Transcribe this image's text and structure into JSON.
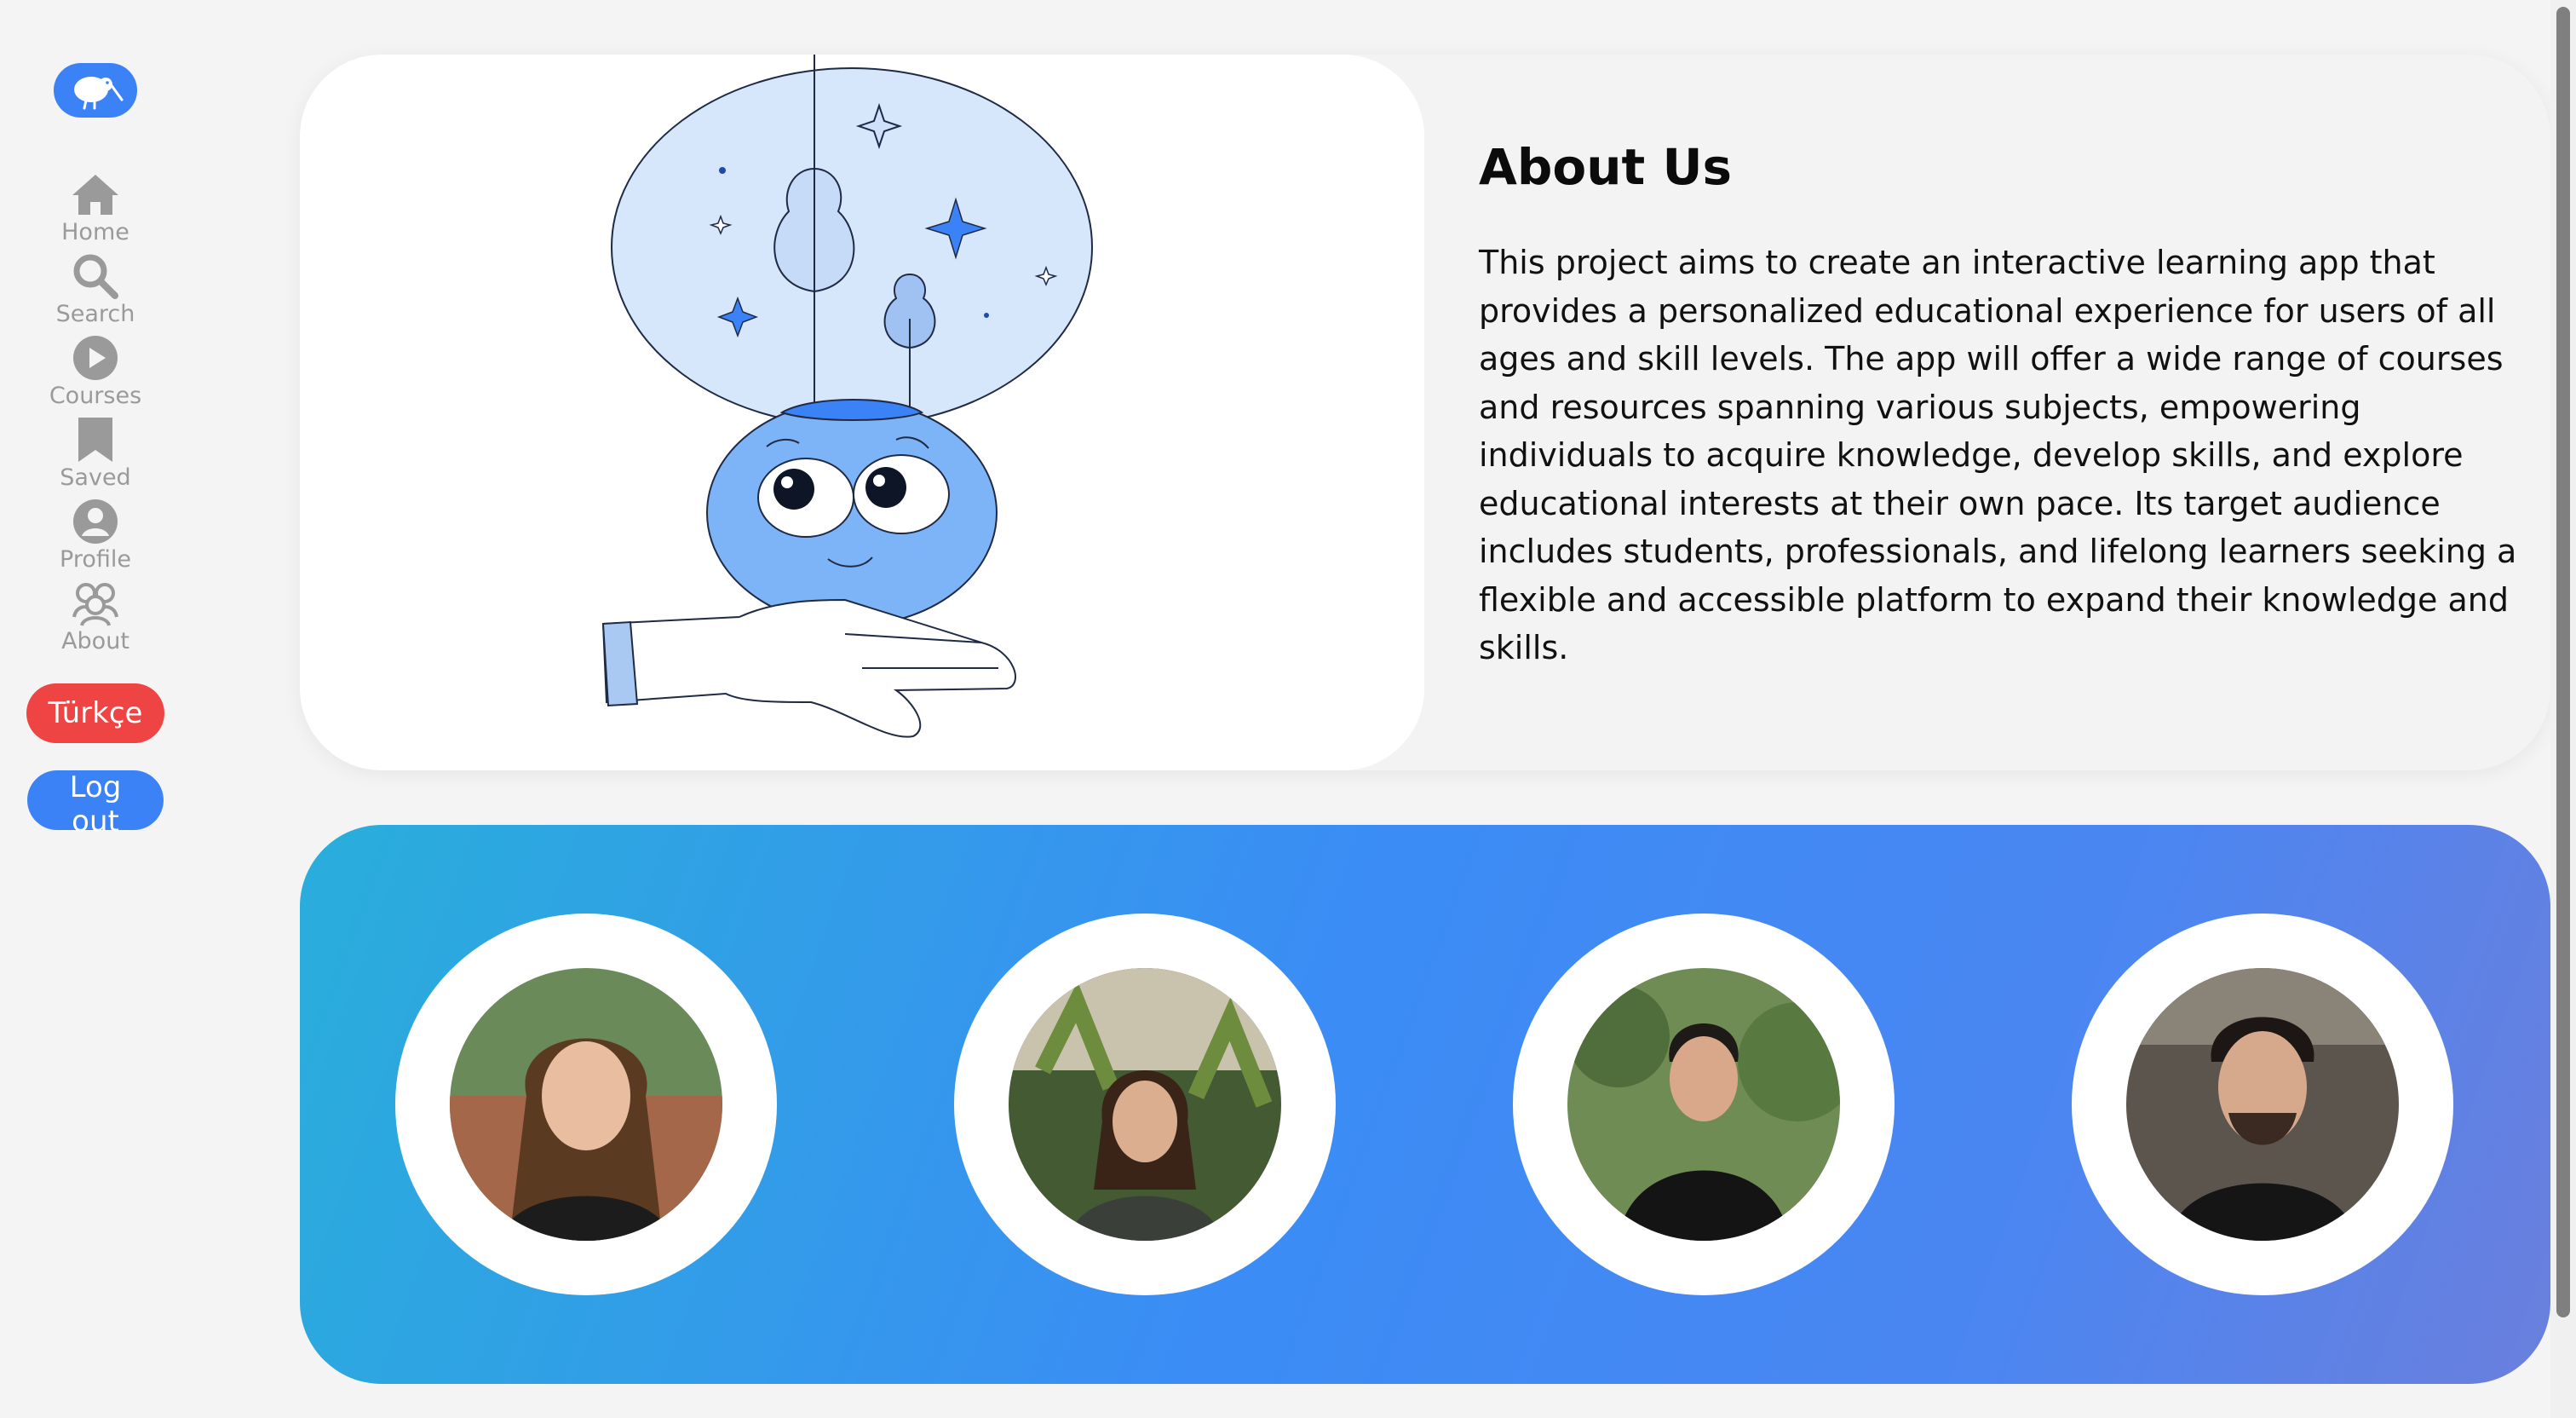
{
  "sidebar": {
    "logo_icon": "kiwi-bird-icon",
    "items": [
      {
        "label": "Home",
        "icon": "home-icon"
      },
      {
        "label": "Search",
        "icon": "search-icon"
      },
      {
        "label": "Courses",
        "icon": "play-icon"
      },
      {
        "label": "Saved",
        "icon": "bookmark-icon"
      },
      {
        "label": "Profile",
        "icon": "user-icon"
      },
      {
        "label": "About",
        "icon": "users-icon"
      }
    ],
    "language_button": "Türkçe",
    "logout_button": "Log out"
  },
  "about": {
    "title": "About Us",
    "body": "This project aims to create an interactive learning app that provides a personalized educational experience for users of all ages and skill levels. The app will offer a wide range of courses and resources spanning various subjects, empowering individuals to acquire knowledge, develop skills, and explore educational interests at their own pace. Its target audience includes students, professionals, and lifelong learners seeking a flexible and accessible platform to expand their knowledge and skills."
  },
  "team": {
    "members": [
      {
        "photo": "team-member-photo-1"
      },
      {
        "photo": "team-member-photo-2"
      },
      {
        "photo": "team-member-photo-3"
      },
      {
        "photo": "team-member-photo-4"
      }
    ]
  },
  "colors": {
    "accent": "#3b82f6",
    "danger": "#ef4444",
    "nav_text": "#9a9a9a",
    "page_bg": "#f4f4f4"
  }
}
